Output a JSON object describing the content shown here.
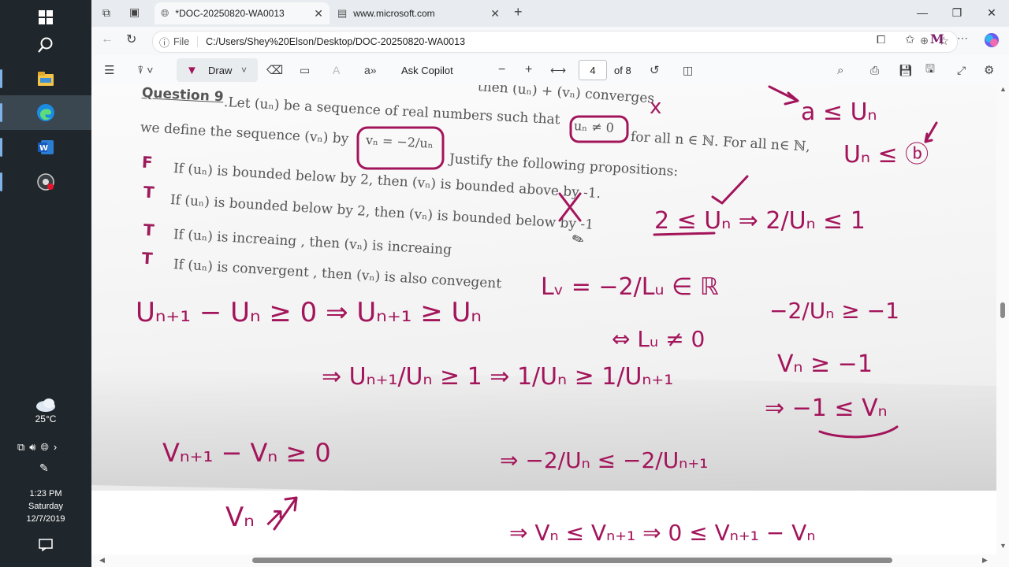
{
  "taskbar": {
    "weather_temp": "25°C",
    "time": "1:23 PM",
    "day": "Saturday",
    "date": "12/7/2019"
  },
  "browser": {
    "tabs": [
      {
        "label": "*DOC-20250820-WA0013",
        "active": true
      },
      {
        "label": "www.microsoft.com",
        "active": false
      }
    ],
    "address": {
      "scheme_label": "File",
      "path": "C:/Users/Shey%20Elson/Desktop/DOC-20250820-WA0013"
    }
  },
  "pdf_toolbar": {
    "draw_label": "Draw",
    "ask_copilot_label": "Ask Copilot",
    "current_page": "4",
    "total_pages": "of 8"
  },
  "document": {
    "question_title": "Question 9",
    "intro_line": ".Let (uₙ) be a sequence of real numbers such that",
    "intro_tail": "for all n ∈ ℕ. For all n∈ ℕ,",
    "top_partial": "then (uₙ) + (vₙ) converges",
    "define_line": "we define the sequence (vₙ) by",
    "justify_line": "Justify the following propositions:",
    "boxed_un": "uₙ ≠ 0",
    "boxed_vn": "vₙ = −2/uₙ",
    "propositions": [
      {
        "mark": "F",
        "text": "If (uₙ) is bounded below by  2, then  (vₙ) is bounded above by -1."
      },
      {
        "mark": "T",
        "text": "If (uₙ) is bounded below by  2, then  (vₙ) is bounded below by -1"
      },
      {
        "mark": "T",
        "text": "If (uₙ) is increaing , then (vₙ) is increaing"
      },
      {
        "mark": "T",
        "text": "If (uₙ) is convergent , then (vₙ) is also convegent"
      }
    ]
  },
  "handwriting": {
    "x_mark": "x",
    "top_right_1": "a ≤ Uₙ",
    "top_right_2": "Uₙ ≤ ⓑ",
    "line_bound": "2 ≤ Uₙ  ⇒  2/Uₙ ≤ 1",
    "frac_neg": "−2/Uₙ ≥ −1",
    "vn_ge": "Vₙ ≥ −1",
    "implies_vn": "⇒ −1 ≤ Vₙ",
    "limit_def": "Lᵥ = −2/Lᵤ ∈ ℝ",
    "limit_cond": "⇔ Lᵤ ≠ 0",
    "diff_line": "Uₙ₊₁ − Uₙ ≥ 0 ⇒ Uₙ₊₁ ≥ Uₙ",
    "ratio_line": "⇒ Uₙ₊₁/Uₙ ≥ 1 ⇒ 1/Uₙ ≥ 1/Uₙ₊₁",
    "neg_line": "⇒ −2/Uₙ ≤ −2/Uₙ₊₁",
    "vdiff": "Vₙ₊₁ − Vₙ ≥ 0",
    "final_line": "⇒ Vₙ ≤ Vₙ₊₁ ⇒ 0 ≤ Vₙ₊₁ − Vₙ",
    "vn_increasing": "Vₙ ↗"
  },
  "colors": {
    "ink": "#a3155b",
    "taskbar": "#20272c"
  }
}
